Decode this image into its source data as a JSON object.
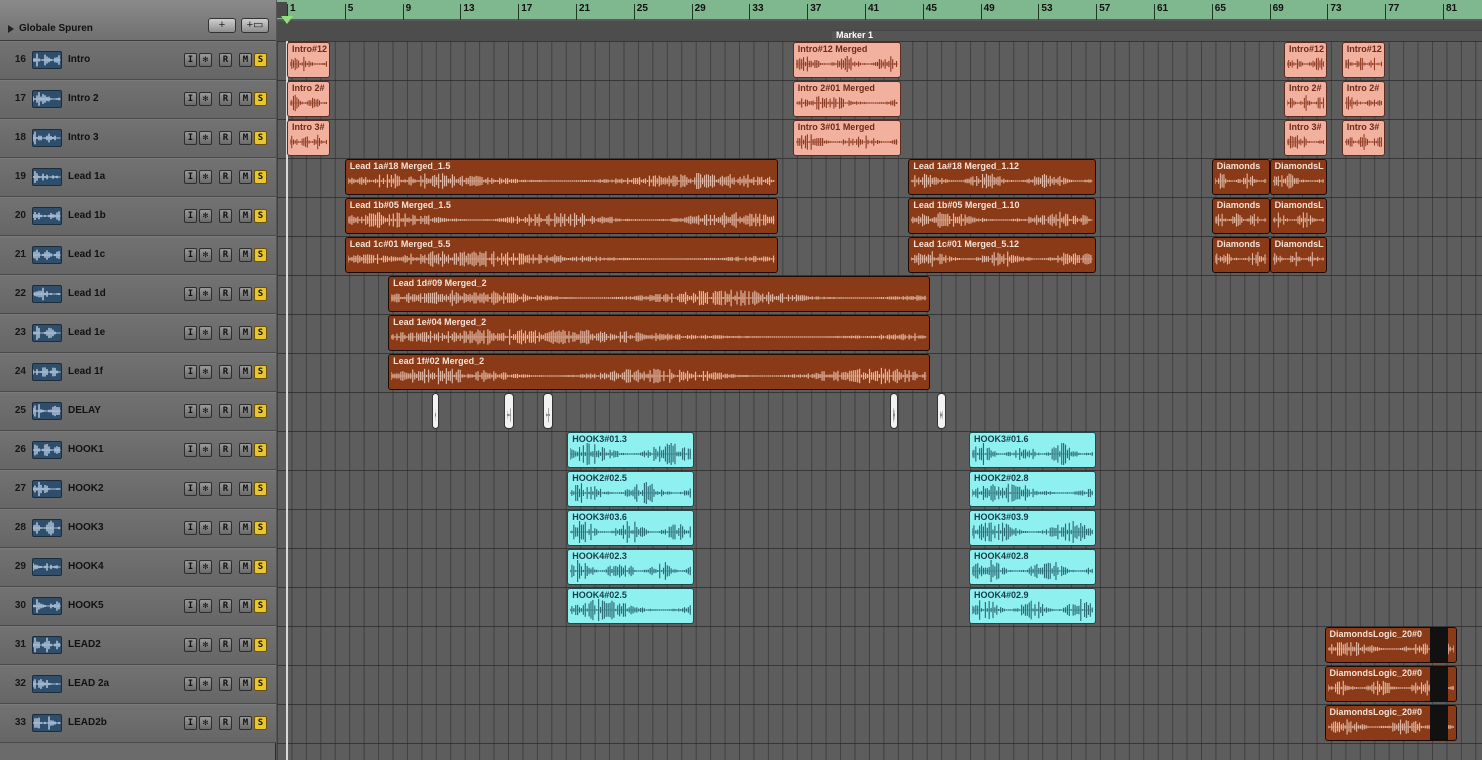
{
  "global_tracks": {
    "label": "Globale Spuren",
    "add_label": "+",
    "add_folder_label": "+▭"
  },
  "ruler": {
    "bars": [
      "1",
      "5",
      "9",
      "13",
      "17",
      "21",
      "25",
      "29",
      "33",
      "37",
      "41",
      "45",
      "49",
      "53",
      "57",
      "61",
      "65",
      "69",
      "73",
      "77",
      "81"
    ],
    "marker": "Marker 1"
  },
  "tracks": [
    {
      "num": "16",
      "name": "Intro"
    },
    {
      "num": "17",
      "name": "Intro 2"
    },
    {
      "num": "18",
      "name": "Intro 3"
    },
    {
      "num": "19",
      "name": "Lead 1a"
    },
    {
      "num": "20",
      "name": "Lead 1b"
    },
    {
      "num": "21",
      "name": "Lead 1c"
    },
    {
      "num": "22",
      "name": "Lead 1d"
    },
    {
      "num": "23",
      "name": "Lead 1e"
    },
    {
      "num": "24",
      "name": "Lead 1f"
    },
    {
      "num": "25",
      "name": "DELAY"
    },
    {
      "num": "26",
      "name": "HOOK1"
    },
    {
      "num": "27",
      "name": "HOOK2"
    },
    {
      "num": "28",
      "name": "HOOK3"
    },
    {
      "num": "29",
      "name": "HOOK4"
    },
    {
      "num": "30",
      "name": "HOOK5"
    },
    {
      "num": "31",
      "name": "LEAD2"
    },
    {
      "num": "32",
      "name": "LEAD 2a"
    },
    {
      "num": "33",
      "name": "LEAD2b"
    }
  ],
  "track_buttons": [
    "I",
    "✻",
    "R",
    "M",
    "S"
  ],
  "regions": [
    {
      "track": 0,
      "start": 1,
      "end": 4,
      "label": "Intro#12",
      "color": "salmon"
    },
    {
      "track": 0,
      "start": 36,
      "end": 43.5,
      "label": "Intro#12 Merged",
      "color": "salmon"
    },
    {
      "track": 0,
      "start": 70,
      "end": 73,
      "label": "Intro#12",
      "color": "salmon"
    },
    {
      "track": 0,
      "start": 74,
      "end": 77,
      "label": "Intro#12",
      "color": "salmon"
    },
    {
      "track": 1,
      "start": 1,
      "end": 4,
      "label": "Intro 2#",
      "color": "salmon"
    },
    {
      "track": 1,
      "start": 36,
      "end": 43.5,
      "label": "Intro 2#01 Merged",
      "color": "salmon"
    },
    {
      "track": 1,
      "start": 70,
      "end": 73,
      "label": "Intro 2#",
      "color": "salmon"
    },
    {
      "track": 1,
      "start": 74,
      "end": 77,
      "label": "Intro 2#",
      "color": "salmon"
    },
    {
      "track": 2,
      "start": 1,
      "end": 4,
      "label": "Intro 3#",
      "color": "salmon"
    },
    {
      "track": 2,
      "start": 36,
      "end": 43.5,
      "label": "Intro 3#01 Merged",
      "color": "salmon"
    },
    {
      "track": 2,
      "start": 70,
      "end": 73,
      "label": "Intro 3#",
      "color": "salmon"
    },
    {
      "track": 2,
      "start": 74,
      "end": 77,
      "label": "Intro 3#",
      "color": "salmon"
    },
    {
      "track": 3,
      "start": 5,
      "end": 35,
      "label": "Lead 1a#18 Merged_1.5",
      "color": "brown"
    },
    {
      "track": 3,
      "start": 44,
      "end": 57,
      "label": "Lead 1a#18 Merged_1.12",
      "color": "brown"
    },
    {
      "track": 3,
      "start": 65,
      "end": 69,
      "label": "Diamonds",
      "color": "brown"
    },
    {
      "track": 3,
      "start": 69,
      "end": 73,
      "label": "DiamondsL",
      "color": "brown"
    },
    {
      "track": 4,
      "start": 5,
      "end": 35,
      "label": "Lead 1b#05 Merged_1.5",
      "color": "brown"
    },
    {
      "track": 4,
      "start": 44,
      "end": 57,
      "label": "Lead 1b#05 Merged_1.10",
      "color": "brown"
    },
    {
      "track": 4,
      "start": 65,
      "end": 69,
      "label": "Diamonds",
      "color": "brown"
    },
    {
      "track": 4,
      "start": 69,
      "end": 73,
      "label": "DiamondsL",
      "color": "brown"
    },
    {
      "track": 5,
      "start": 5,
      "end": 35,
      "label": "Lead 1c#01 Merged_5.5",
      "color": "brown"
    },
    {
      "track": 5,
      "start": 44,
      "end": 57,
      "label": "Lead 1c#01 Merged_5.12",
      "color": "brown"
    },
    {
      "track": 5,
      "start": 65,
      "end": 69,
      "label": "Diamonds",
      "color": "brown"
    },
    {
      "track": 5,
      "start": 69,
      "end": 73,
      "label": "DiamondsL",
      "color": "brown"
    },
    {
      "track": 6,
      "start": 8,
      "end": 45.5,
      "label": "Lead 1d#09 Merged_2",
      "color": "brown"
    },
    {
      "track": 7,
      "start": 8,
      "end": 45.5,
      "label": "Lead 1e#04 Merged_2",
      "color": "brown"
    },
    {
      "track": 8,
      "start": 8,
      "end": 45.5,
      "label": "Lead 1f#02 Merged_2",
      "color": "brown"
    },
    {
      "track": 9,
      "start": 11,
      "end": 11.5,
      "label": "",
      "color": "white"
    },
    {
      "track": 9,
      "start": 16,
      "end": 16.7,
      "label": "",
      "color": "white"
    },
    {
      "track": 9,
      "start": 18.7,
      "end": 19.4,
      "label": "",
      "color": "white"
    },
    {
      "track": 9,
      "start": 42.7,
      "end": 43.3,
      "label": "",
      "color": "white"
    },
    {
      "track": 9,
      "start": 46,
      "end": 46.6,
      "label": "",
      "color": "white"
    },
    {
      "track": 10,
      "start": 20.4,
      "end": 29.2,
      "label": "HOOK3#01.3",
      "color": "cyan"
    },
    {
      "track": 10,
      "start": 48.2,
      "end": 57,
      "label": "HOOK3#01.6",
      "color": "cyan"
    },
    {
      "track": 11,
      "start": 20.4,
      "end": 29.2,
      "label": "HOOK2#02.5",
      "color": "cyan"
    },
    {
      "track": 11,
      "start": 48.2,
      "end": 57,
      "label": "HOOK2#02.8",
      "color": "cyan"
    },
    {
      "track": 12,
      "start": 20.4,
      "end": 29.2,
      "label": "HOOK3#03.6",
      "color": "cyan"
    },
    {
      "track": 12,
      "start": 48.2,
      "end": 57,
      "label": "HOOK3#03.9",
      "color": "cyan"
    },
    {
      "track": 13,
      "start": 20.4,
      "end": 29.2,
      "label": "HOOK4#02.3",
      "color": "cyan"
    },
    {
      "track": 13,
      "start": 48.2,
      "end": 57,
      "label": "HOOK4#02.8",
      "color": "cyan"
    },
    {
      "track": 14,
      "start": 20.4,
      "end": 29.2,
      "label": "HOOK4#02.5",
      "color": "cyan"
    },
    {
      "track": 14,
      "start": 48.2,
      "end": 57,
      "label": "HOOK4#02.9",
      "color": "cyan"
    },
    {
      "track": 15,
      "start": 72.8,
      "end": 82,
      "label": "DiamondsLogic_20#0",
      "color": "brown",
      "dark_end": true
    },
    {
      "track": 16,
      "start": 72.8,
      "end": 82,
      "label": "DiamondsLogic_20#0",
      "color": "brown",
      "dark_end": true
    },
    {
      "track": 17,
      "start": 72.8,
      "end": 82,
      "label": "DiamondsLogic_20#0",
      "color": "brown",
      "dark_end": true
    }
  ]
}
